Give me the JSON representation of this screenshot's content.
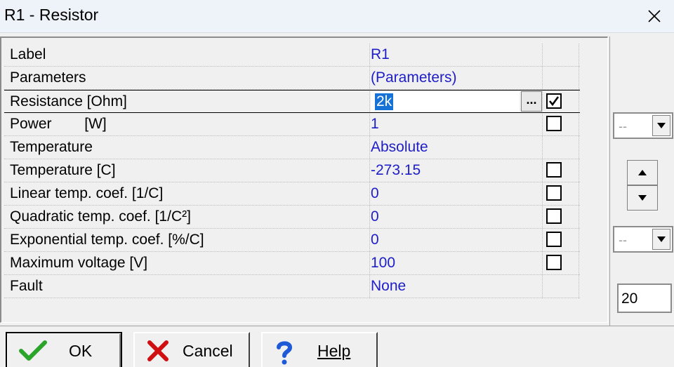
{
  "window": {
    "title": "R1 - Resistor"
  },
  "grid": {
    "rows": [
      {
        "name": "Label",
        "value": "R1",
        "checkbox": null
      },
      {
        "name": "Parameters",
        "value": "(Parameters)",
        "checkbox": null
      },
      {
        "name": "Resistance [Ohm]",
        "value": "2k",
        "checkbox": true,
        "editing": true
      },
      {
        "name": "Power        [W]",
        "value": "1",
        "checkbox": false
      },
      {
        "name": "Temperature",
        "value": "Absolute",
        "checkbox": null
      },
      {
        "name": "Temperature [C]",
        "value": "-273.15",
        "checkbox": false
      },
      {
        "name": "Linear temp. coef. [1/C]",
        "value": "0",
        "checkbox": false
      },
      {
        "name": "Quadratic temp. coef. [1/C²]",
        "value": "0",
        "checkbox": false
      },
      {
        "name": "Exponential temp. coef. [%/C]",
        "value": "0",
        "checkbox": false
      },
      {
        "name": "Maximum voltage [V]",
        "value": "100",
        "checkbox": false
      },
      {
        "name": "Fault",
        "value": "None",
        "checkbox": null
      }
    ],
    "ellipsis_label": "..."
  },
  "side_panel": {
    "combo_top_value": "--",
    "combo_bottom_value": "--",
    "number_value": "20"
  },
  "buttons": {
    "ok": "OK",
    "cancel": "Cancel",
    "help": "Help"
  },
  "colors": {
    "value_text": "#1e1ec8",
    "selection": "#1672d6",
    "ok_check": "#2aa52a",
    "cancel_x": "#d01010",
    "help_q": "#1e5ad8"
  }
}
